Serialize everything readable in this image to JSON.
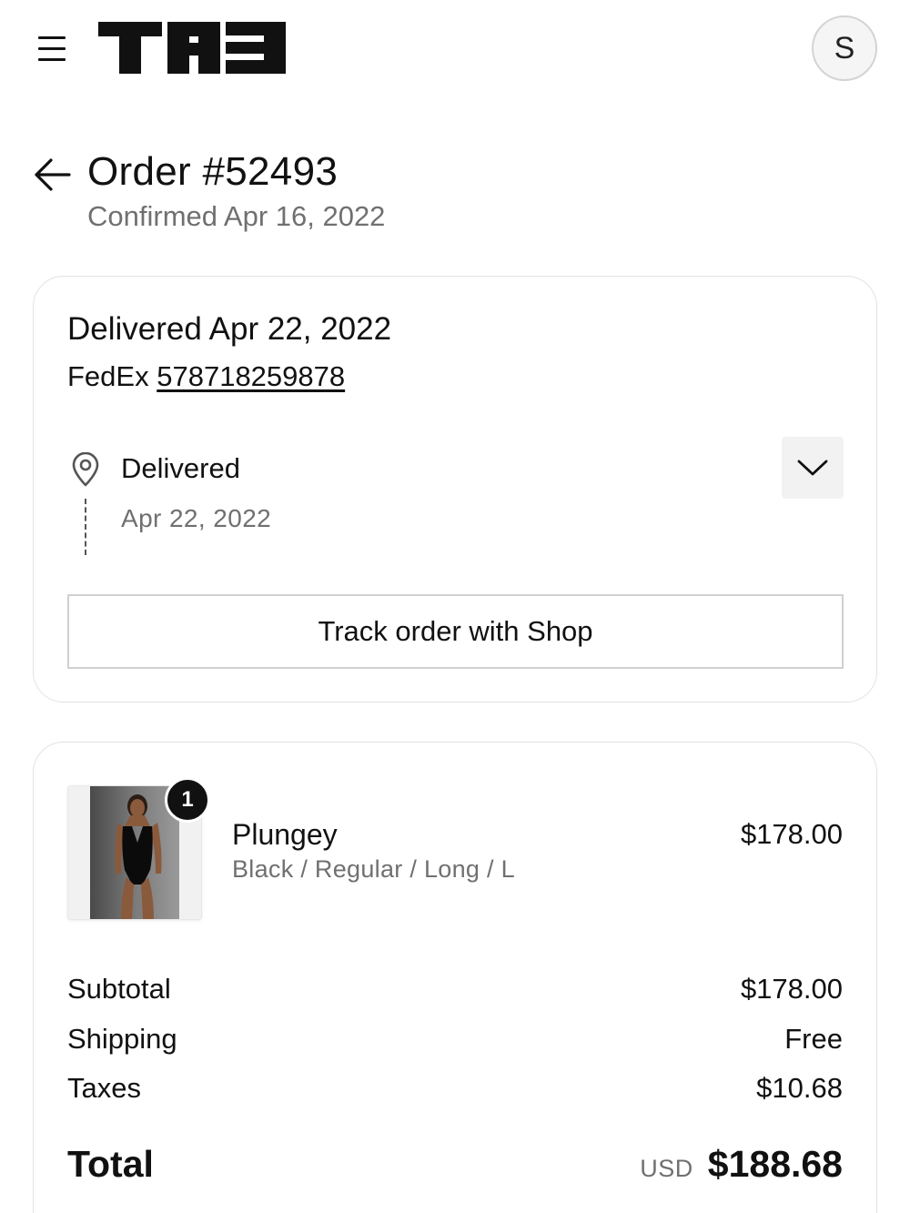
{
  "header": {
    "logo_text": "TAB",
    "avatar_initial": "S"
  },
  "order": {
    "title": "Order #52493",
    "subtitle": "Confirmed Apr 16, 2022"
  },
  "delivery": {
    "title": "Delivered Apr 22, 2022",
    "carrier": "FedEx",
    "tracking_number": "578718259878",
    "status_label": "Delivered",
    "status_date": "Apr 22, 2022",
    "track_button_label": "Track order with Shop"
  },
  "product": {
    "quantity": "1",
    "name": "Plungey",
    "variant": "Black / Regular / Long / L",
    "price": "$178.00"
  },
  "summary": {
    "subtotal_label": "Subtotal",
    "subtotal_value": "$178.00",
    "shipping_label": "Shipping",
    "shipping_value": "Free",
    "taxes_label": "Taxes",
    "taxes_value": "$10.68",
    "total_label": "Total",
    "total_currency": "USD",
    "total_value": "$188.68"
  },
  "icons": {
    "menu": "hamburger-menu-icon",
    "back": "arrow-left-icon",
    "pin": "location-pin-icon",
    "expand": "chevron-down-icon"
  }
}
